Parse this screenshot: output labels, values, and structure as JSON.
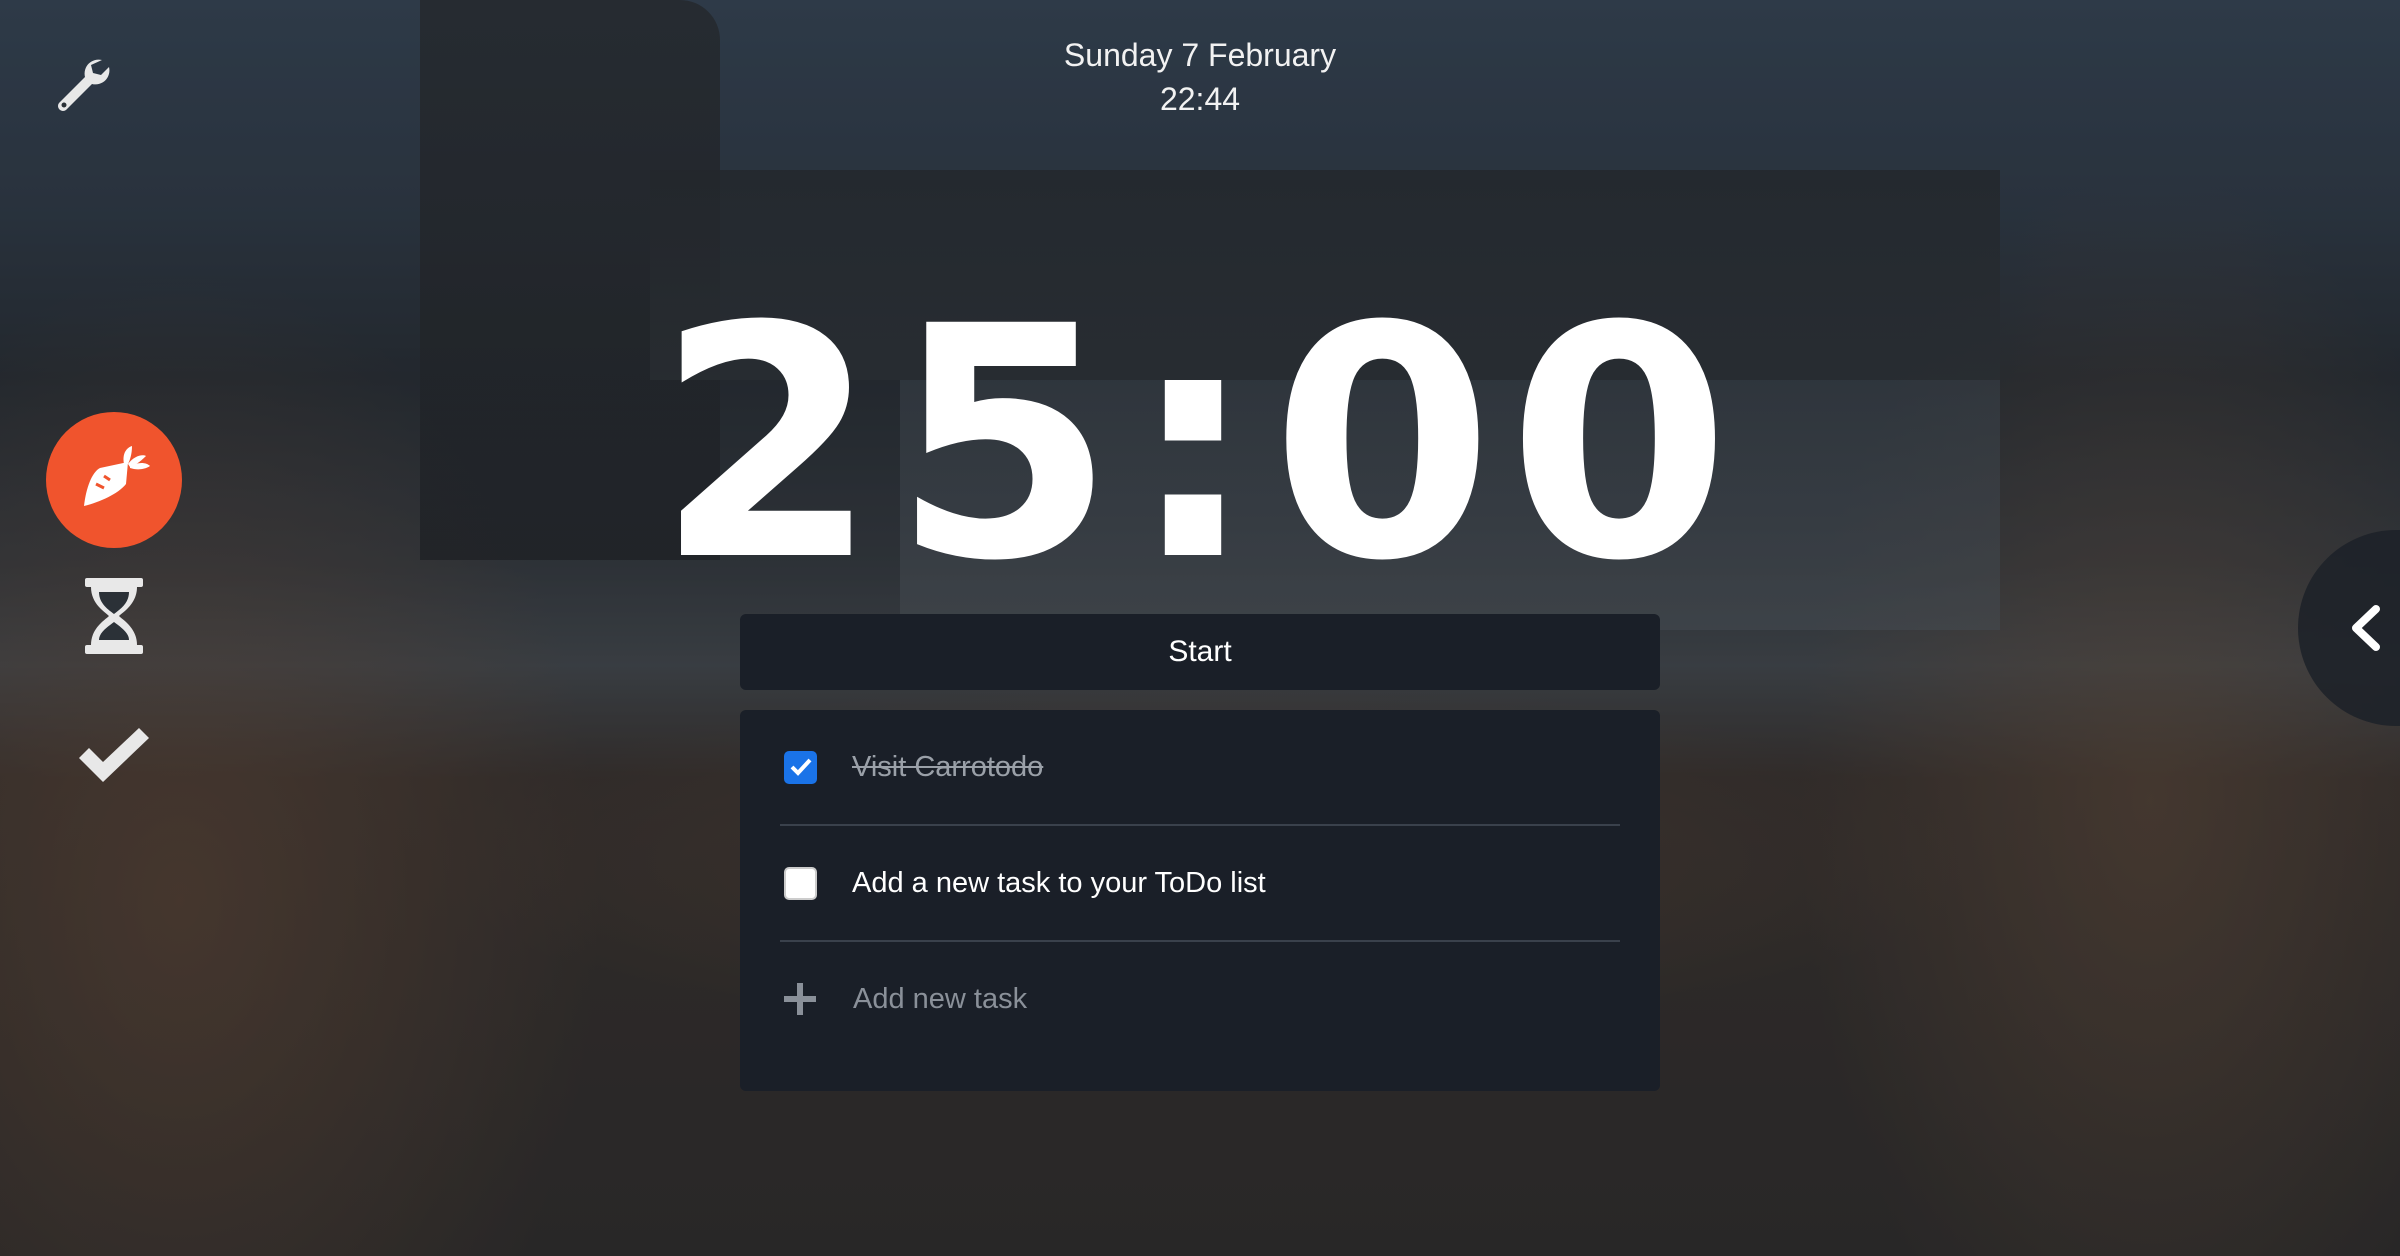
{
  "header": {
    "date": "Sunday 7 February",
    "time": "22:44"
  },
  "toolbar": {
    "settings_icon": "wrench-icon"
  },
  "nav": {
    "items": [
      {
        "name": "carrot",
        "icon": "carrot-icon",
        "active": true
      },
      {
        "name": "timer",
        "icon": "hourglass-icon",
        "active": false
      },
      {
        "name": "tasks",
        "icon": "checkmark-icon",
        "active": false
      }
    ]
  },
  "timer": {
    "display": "25:00"
  },
  "controls": {
    "start_label": "Start"
  },
  "todos": {
    "items": [
      {
        "text": "Visit Carrotodo",
        "done": true
      },
      {
        "text": "Add a new task to your ToDo list",
        "done": false
      }
    ],
    "add_placeholder": "Add new task"
  },
  "side_panel": {
    "toggle_icon": "chevron-left-icon"
  },
  "colors": {
    "accent": "#f0542d",
    "panel": "#1a1f28",
    "checkbox": "#1a73e8"
  }
}
